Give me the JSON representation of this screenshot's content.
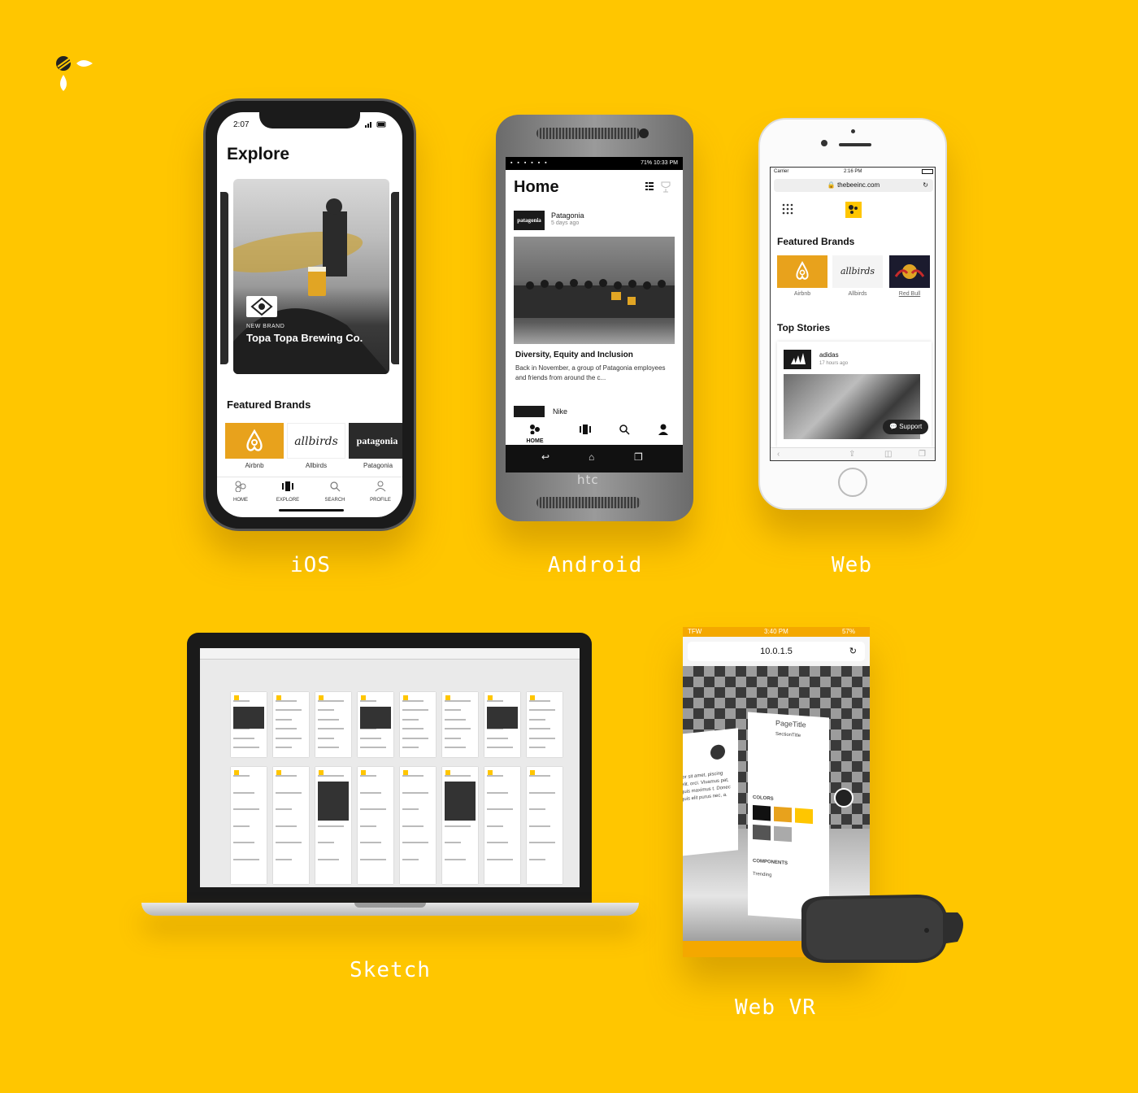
{
  "captions": {
    "ios": "iOS",
    "android": "Android",
    "web": "Web",
    "sketch": "Sketch",
    "webvr": "Web VR"
  },
  "colors": {
    "background": "#ffc600",
    "accent": "#e8a21c"
  },
  "ios": {
    "time": "2:07",
    "title": "Explore",
    "hero_kicker": "NEW BRAND",
    "hero_title": "Topa Topa Brewing Co.",
    "featured_heading": "Featured Brands",
    "brands": [
      {
        "name": "Airbnb",
        "logo": "airbnb-logo"
      },
      {
        "name": "Allbirds",
        "logo": "allbirds"
      },
      {
        "name": "Patagonia",
        "logo": "patagonia"
      }
    ],
    "tabs": [
      {
        "label": "HOME",
        "icon": "home-icon"
      },
      {
        "label": "EXPLORE",
        "icon": "explore-icon"
      },
      {
        "label": "SEARCH",
        "icon": "search-icon"
      },
      {
        "label": "PROFILE",
        "icon": "profile-icon"
      }
    ]
  },
  "android": {
    "battery": "71%",
    "time": "10:33 PM",
    "title": "Home",
    "post_brand_logo": "patagonia",
    "post_brand": "Patagonia",
    "post_date": "5 days ago",
    "headline": "Diversity, Equity and Inclusion",
    "excerpt": "Back in November, a group of Patagonia employees and friends from around the c...",
    "next_brand": "Nike",
    "home_tab": "HOME",
    "device_brand": "htc"
  },
  "web": {
    "carrier": "Carrier",
    "time": "2:16 PM",
    "url": "thebeeinc.com",
    "featured_heading": "Featured Brands",
    "brands": [
      {
        "name": "Airbnb"
      },
      {
        "name": "Allbirds",
        "logo": "allbirds"
      },
      {
        "name": "Red Bull"
      }
    ],
    "top_stories_heading": "Top Stories",
    "story_brand": "adidas",
    "story_date": "17 hours ago",
    "support_label": "Support"
  },
  "webvr": {
    "carrier": "TFW",
    "time": "3:40 PM",
    "battery": "57%",
    "url": "10.0.1.5",
    "page_title": "PageTitle",
    "section_title": "SectionTitle",
    "colors_label": "COLORS",
    "components_label": "COMPONENTS",
    "trending_label": "Trending",
    "lorem": "lor sit amet, piscing elit. orci. Vivamus pat, quis maximus t. Donec quis elit purus nec, a."
  }
}
